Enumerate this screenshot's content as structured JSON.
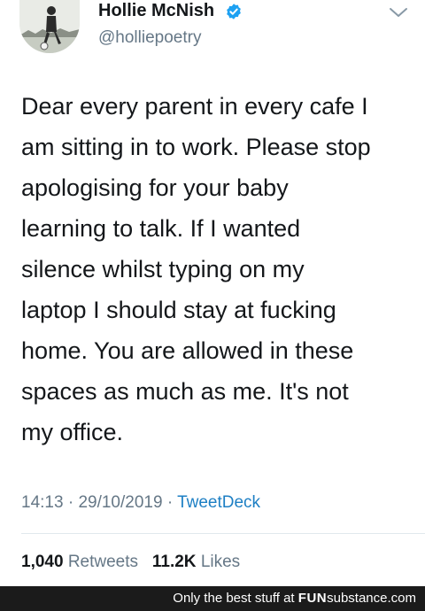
{
  "user": {
    "display_name": "Hollie McNish",
    "handle": "@holliepoetry",
    "verified": true
  },
  "tweet": {
    "text": "Dear every parent in every cafe I\nam sitting in to work. Please stop\napologising for your baby\nlearning to talk. If I wanted\nsilence whilst typing on my\nlaptop I should stay at fucking\nhome. You are allowed in these\nspaces as much as me. It's not\nmy office.",
    "time": "14:13",
    "date": "29/10/2019",
    "separator": "·",
    "source": "TweetDeck"
  },
  "stats": {
    "retweets_count": "1,040",
    "retweets_label": "Retweets",
    "likes_count": "11.2K",
    "likes_label": "Likes"
  },
  "watermark": {
    "text": "Only the best stuff at",
    "brand_bold": "FUN",
    "brand_rest": "substance.com"
  },
  "colors": {
    "text_primary": "#14171a",
    "text_secondary": "#657786",
    "link": "#1d7fc4",
    "verified_badge": "#1da1f2",
    "footer_bg": "#1b1b1b"
  },
  "icons": {
    "verified": "verified-badge-icon",
    "menu": "chevron-down-icon"
  }
}
